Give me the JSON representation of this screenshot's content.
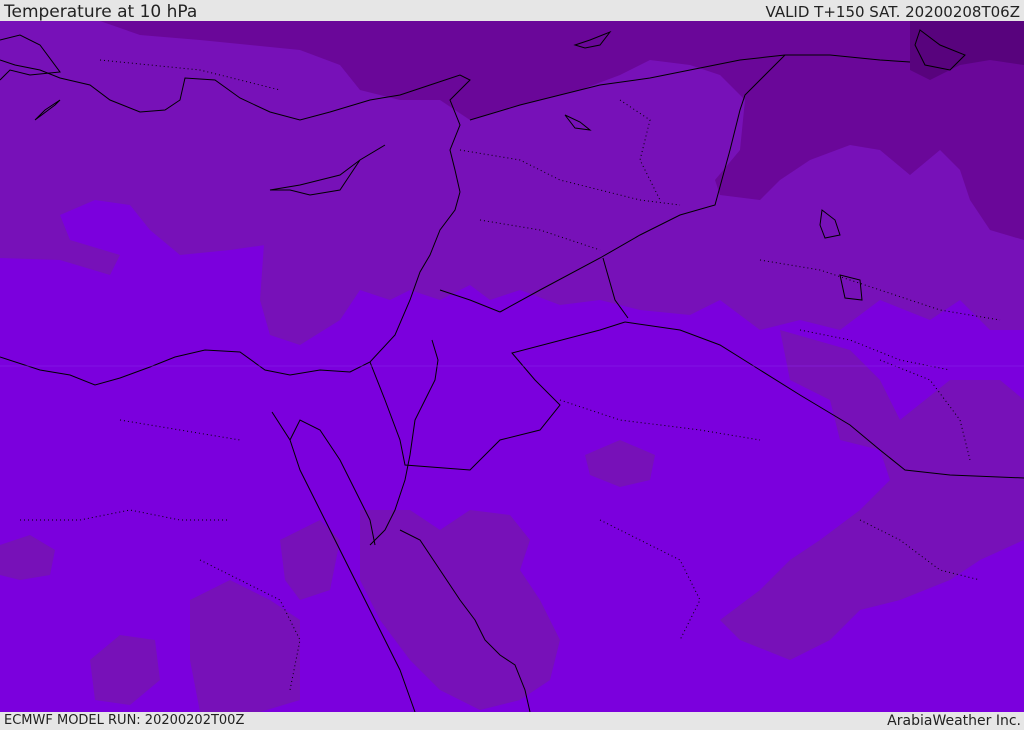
{
  "header": {
    "title": "Temperature at 10 hPa",
    "valid": "VALID T+150 SAT. 20200208T06Z"
  },
  "footer": {
    "model_run": "ECMWF MODEL RUN: 20200202T00Z",
    "brand": "ArabiaWeather Inc."
  },
  "map": {
    "colors": {
      "level_warmest": "#7b00dd",
      "level_mid": "#7711b8",
      "level_cool": "#6a0799",
      "level_coldest": "#58037d",
      "coastline": "#000000",
      "border": "#000000"
    }
  }
}
